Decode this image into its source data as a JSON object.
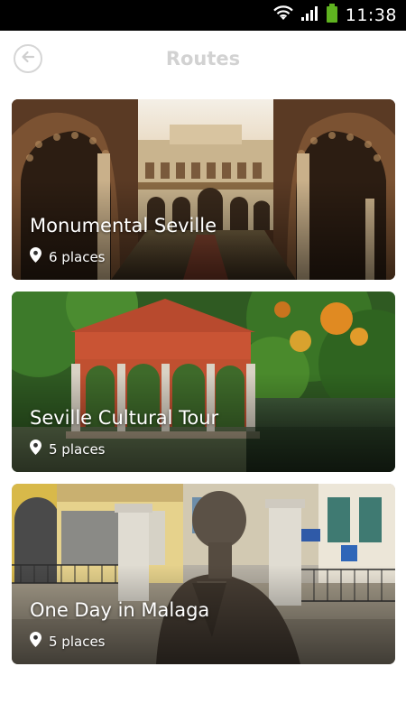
{
  "status_bar": {
    "time": "11:38",
    "icons": [
      "wifi-icon",
      "signal-icon",
      "battery-icon"
    ],
    "battery_color": "#5fb320"
  },
  "header": {
    "title": "Routes",
    "back_icon": "back-arrow-icon"
  },
  "routes": [
    {
      "title": "Monumental Seville",
      "places": "6 places",
      "icon": "location-pin-icon"
    },
    {
      "title": "Seville Cultural Tour",
      "places": "5 places",
      "icon": "location-pin-icon"
    },
    {
      "title": "One Day in Malaga",
      "places": "5 places",
      "icon": "location-pin-icon"
    }
  ],
  "colors": {
    "title_text": "#d2d2d2",
    "back_button_border": "#d6d6d6",
    "card_text": "#ffffff"
  }
}
